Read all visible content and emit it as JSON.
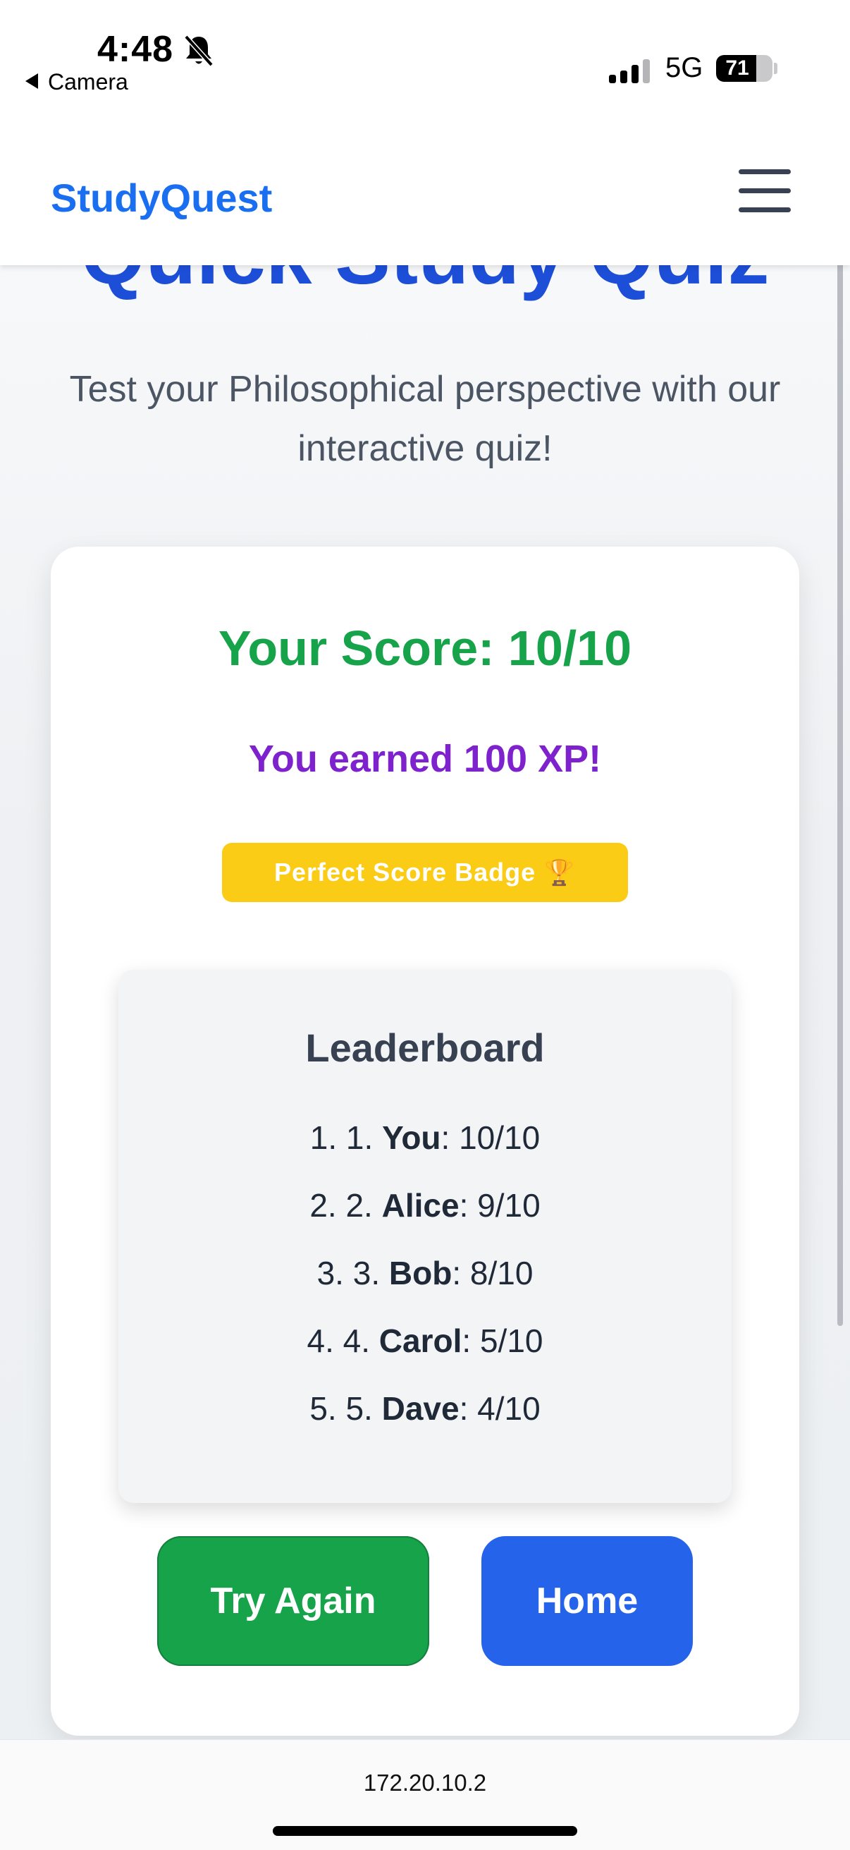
{
  "status_bar": {
    "time": "4:48",
    "back_label": "Camera",
    "network": "5G",
    "battery": "71",
    "battery_level": 0.71
  },
  "header": {
    "brand": "StudyQuest"
  },
  "page": {
    "title": "Quick Study Quiz",
    "subtitle": "Test your Philosophical perspective with our interactive quiz!"
  },
  "result": {
    "score_text": "Your Score: 10/10",
    "xp_text": "You earned 100 XP!",
    "badge_text": "Perfect Score Badge 🏆"
  },
  "leaderboard": {
    "title": "Leaderboard",
    "entries": [
      {
        "prefix": "1. 1. ",
        "name": "You",
        "score": ": 10/10"
      },
      {
        "prefix": "2. 2. ",
        "name": "Alice",
        "score": ": 9/10"
      },
      {
        "prefix": "3. 3. ",
        "name": "Bob",
        "score": ": 8/10"
      },
      {
        "prefix": "4. 4. ",
        "name": "Carol",
        "score": ": 5/10"
      },
      {
        "prefix": "5. 5. ",
        "name": "Dave",
        "score": ": 4/10"
      }
    ]
  },
  "actions": {
    "try_again": "Try Again",
    "home": "Home"
  },
  "browser": {
    "url": "172.20.10.2"
  },
  "colors": {
    "brand": "#1a6ef0",
    "title": "#1d4ed8",
    "score": "#16a34a",
    "xp": "#7e22ce",
    "badge": "#facc15",
    "home_button": "#2563eb"
  }
}
